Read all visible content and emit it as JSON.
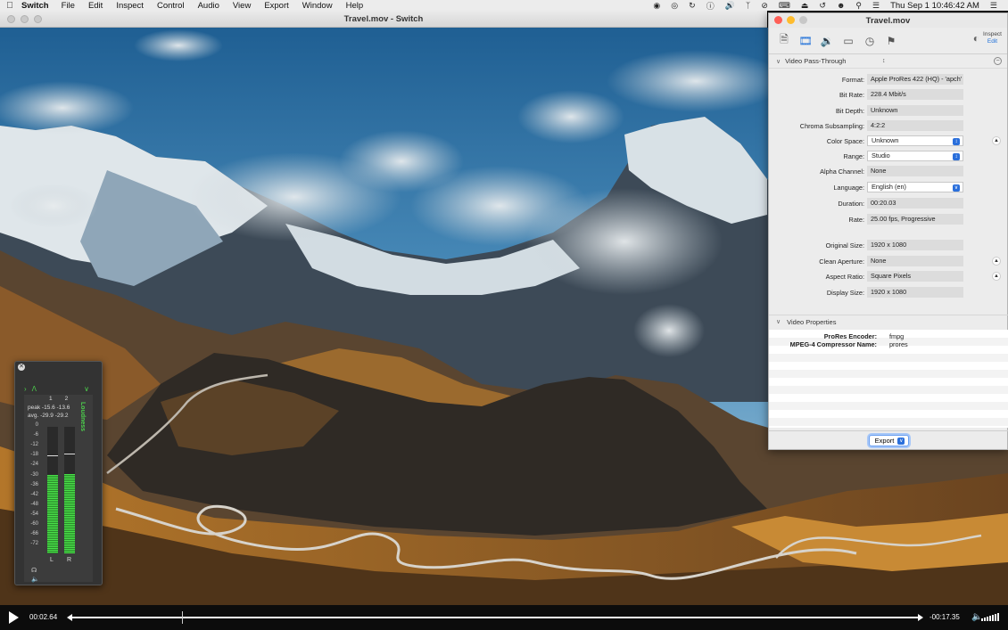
{
  "menubar": {
    "app": "Switch",
    "items": [
      "File",
      "Edit",
      "Inspect",
      "Control",
      "Audio",
      "View",
      "Export",
      "Window",
      "Help"
    ],
    "clock": "Thu Sep 1  10:46:42 AM"
  },
  "player": {
    "window_title": "Travel.mov - Switch",
    "time_elapsed": "00:02.64",
    "time_remaining": "-00:17.35",
    "progress": 0.1318
  },
  "inspector": {
    "title": "Travel.mov",
    "toolbar_icons": [
      "document-icon",
      "video-icon",
      "audio-icon",
      "subtitle-icon",
      "clock-icon",
      "flag-icon"
    ],
    "inspect_label": "Inspect",
    "edit_label": "Edit",
    "section1": "Video Pass-Through",
    "props": [
      {
        "label": "Format:",
        "value": "Apple ProRes 422 (HQ) - 'apch'"
      },
      {
        "label": "Bit Rate:",
        "value": "228.4 Mbit/s"
      },
      {
        "label": "Bit Depth:",
        "value": "Unknown"
      },
      {
        "label": "Chroma Subsampling:",
        "value": "4:2:2"
      },
      {
        "label": "Color Space:",
        "value": "Unknown"
      },
      {
        "label": "Range:",
        "value": "Studio"
      },
      {
        "label": "Alpha Channel:",
        "value": "None"
      },
      {
        "label": "Language:",
        "value": "English (en)"
      },
      {
        "label": "Duration:",
        "value": "00:20.03"
      },
      {
        "label": "Rate:",
        "value": "25.00 fps, Progressive"
      },
      {
        "label": "Original Size:",
        "value": "1920 x 1080"
      },
      {
        "label": "Clean Aperture:",
        "value": "None"
      },
      {
        "label": "Aspect Ratio:",
        "value": "Square Pixels"
      },
      {
        "label": "Display Size:",
        "value": "1920 x 1080"
      }
    ],
    "section2": "Video Properties",
    "video_props": [
      {
        "key": "ProRes Encoder:",
        "value": "fmpg"
      },
      {
        "key": "MPEG-4 Compressor Name:",
        "value": "prores"
      }
    ],
    "export_label": "Export"
  },
  "meter": {
    "ch1": "1",
    "ch2": "2",
    "peak_label": "peak",
    "peak_values": "-15.6 -13.6",
    "avg_label": "avg.",
    "avg_values": "-29.9 -29.2",
    "loudness_label": "Loudness",
    "scale": [
      "0",
      "-6",
      "-12",
      "-18",
      "-24",
      "-30",
      "-36",
      "-42",
      "-48",
      "-54",
      "-60",
      "-66",
      "-72"
    ],
    "left_label": "L",
    "right_label": "R",
    "level_left": 0.62,
    "level_right": 0.63
  }
}
